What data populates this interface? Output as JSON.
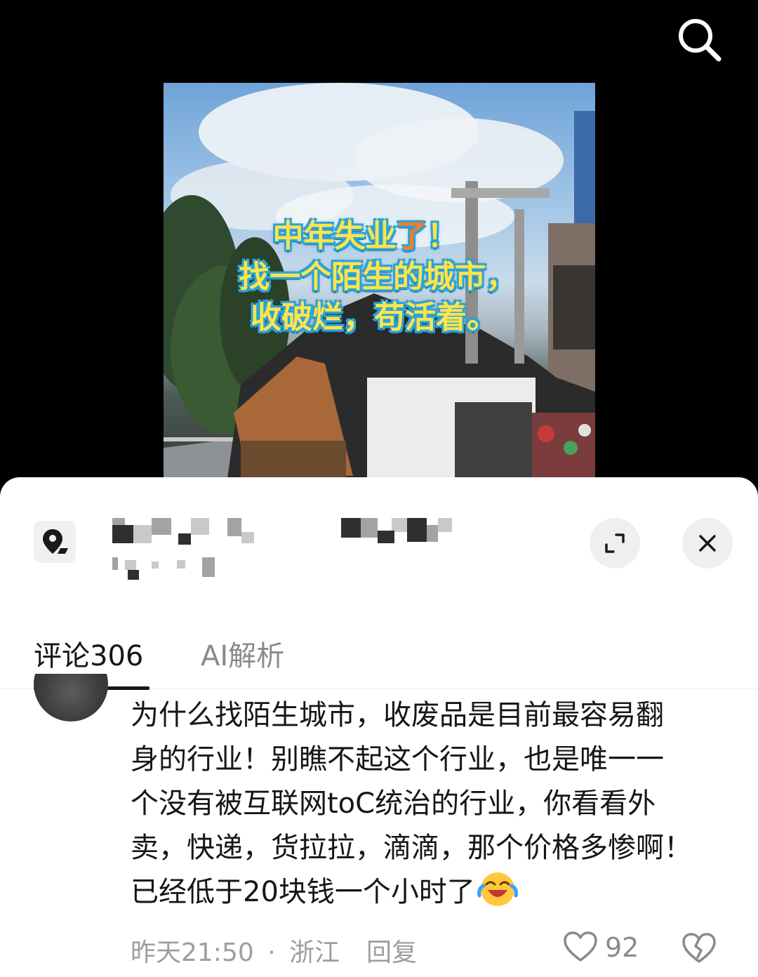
{
  "video": {
    "overlay_lines": [
      "中年失业",
      "了",
      "！",
      "找一个陌生的城市，",
      "收破烂，苟活着。"
    ],
    "search_icon": "search-icon"
  },
  "sheet": {
    "expand_icon": "expand-icon",
    "close_icon": "close-icon",
    "location_icon": "location-pin-icon"
  },
  "tabs": [
    {
      "label": "评论306"
    },
    {
      "label": "AI解析"
    }
  ],
  "comment": {
    "lines": [
      "为什么找陌生城市，收废品是目前最容易翻",
      "身的行业！别瞧不起这个行业，也是唯一一",
      "个没有被互联网toC统治的行业，你看看外",
      "卖，快递，货拉拉，滴滴，那个价格多惨啊！",
      "已经低于20块钱一个小时了"
    ],
    "emoji": "laughing-crying-emoji",
    "time": "昨天21:50",
    "separator": "·",
    "region": "浙江",
    "reply_label": "回复",
    "like_count": "92"
  },
  "colors": {
    "text": "#161616",
    "muted": "#9e9e9e",
    "overlay_yellow": "#ffe44a",
    "overlay_orange": "#ff7a24",
    "overlay_outline": "#2aa3d8"
  }
}
